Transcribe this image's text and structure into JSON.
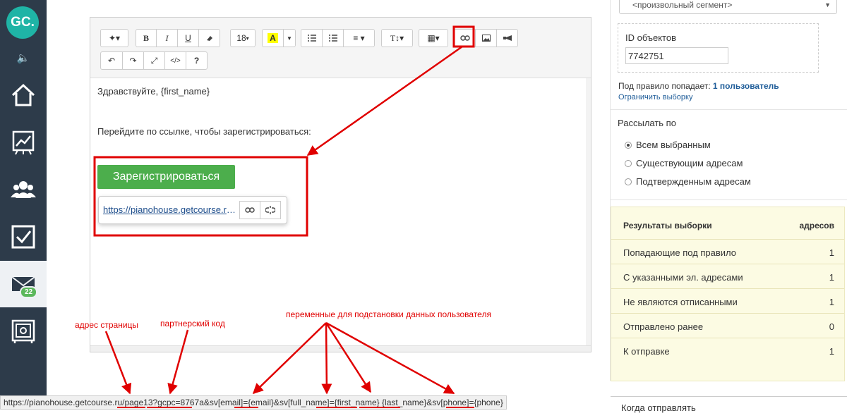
{
  "sidebar": {
    "logo": "GC.",
    "badge": "22",
    "items": [
      "home-icon",
      "chart-icon",
      "users-icon",
      "checkbox-icon",
      "mail-icon",
      "safe-icon"
    ]
  },
  "editor": {
    "toolbar": {
      "font_size": "18",
      "font_size_caret": "▾",
      "help": "?",
      "code": "</>"
    },
    "content": {
      "greeting": "Здравствуйте, {first_name}",
      "instruction": "Перейдите по ссылке, чтобы зарегистрироваться:",
      "button_label": "Зарегистрироваться",
      "link_url": "https://pianohouse.getcourse.ru/page13?gcpc=8767a"
    }
  },
  "right_panel": {
    "segment_select": "<произвольный сегмент>",
    "ids_label": "ID объектов",
    "ids_value": "7742751",
    "rule_prefix": "Под правило попадает:",
    "rule_count": "1 пользователь",
    "limit_link": "Ограничить выборку",
    "send_label": "Рассылать по",
    "radios": [
      {
        "label": "Всем выбранным",
        "checked": true
      },
      {
        "label": "Существующим адресам",
        "checked": false
      },
      {
        "label": "Подтвержденным адресам",
        "checked": false
      }
    ],
    "results": {
      "title": "Результаты выборки",
      "col": "адресов",
      "rows": [
        {
          "label": "Попадающие под правило",
          "value": "1"
        },
        {
          "label": "С указанными эл. адресами",
          "value": "1"
        },
        {
          "label": "Не являются отписанными",
          "value": "1"
        },
        {
          "label": "Отправлено ранее",
          "value": "0"
        },
        {
          "label": "К отправке",
          "value": "1"
        }
      ]
    },
    "bottom_label": "Когда отправлять"
  },
  "status_bar": {
    "url": "https://pianohouse.getcourse.ru/page13?gcpc=8767a&sv[email]={email}&sv[full_name]={first_name} {last_name}&sv[phone]={phone}"
  },
  "annotations": {
    "page_address": "адрес страницы",
    "partner_code": "партнерский код",
    "variables": "переменные для подстановки данных пользователя"
  },
  "colors": {
    "sidebar": "#2d3b4a",
    "logo": "#1fb4a6",
    "register_button": "#4cae4c",
    "annotation": "#e00000",
    "link": "#1f5d99",
    "results_bg": "#fcfbe3"
  }
}
